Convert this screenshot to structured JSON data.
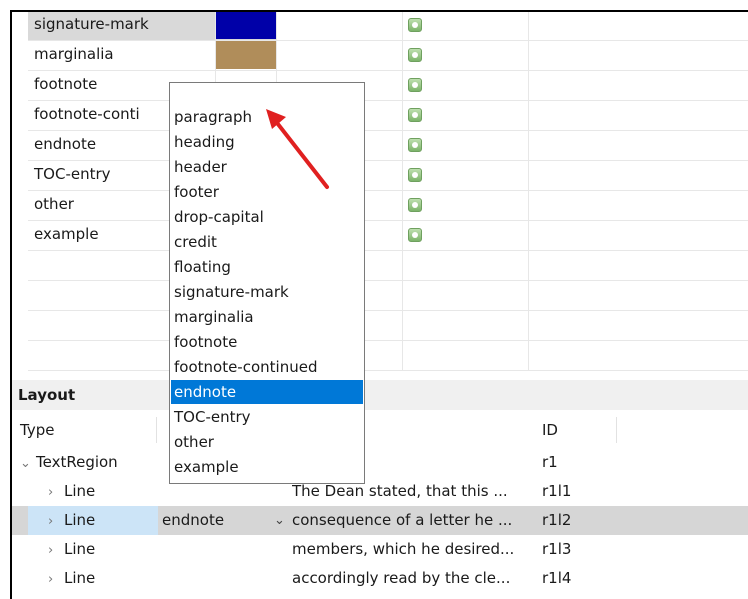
{
  "structure_rows": [
    {
      "name": "signature-mark",
      "color": "#0000a8",
      "selected": true
    },
    {
      "name": "marginalia",
      "color": "#b08d5a"
    },
    {
      "name": "footnote",
      "color": ""
    },
    {
      "name": "footnote-conti",
      "color": ""
    },
    {
      "name": "endnote",
      "color": ""
    },
    {
      "name": "TOC-entry",
      "color": ""
    },
    {
      "name": "other",
      "color": ""
    },
    {
      "name": "example",
      "color": ""
    }
  ],
  "layout": {
    "title": "Layout",
    "columns": {
      "type": "Type",
      "id": "ID"
    },
    "rows": [
      {
        "type": "TextRegion",
        "expanded": true,
        "level": 0,
        "struct": "",
        "text": "",
        "id": "r1"
      },
      {
        "type": "Line",
        "level": 1,
        "struct": "",
        "text": "The Dean stated, that this ...",
        "id": "r1l1"
      },
      {
        "type": "Line",
        "level": 1,
        "struct": "endnote",
        "text": "consequence of a letter he ...",
        "id": "r1l2",
        "selected": true
      },
      {
        "type": "Line",
        "level": 1,
        "struct": "",
        "text": "members, which he desired...",
        "id": "r1l3"
      },
      {
        "type": "Line",
        "level": 1,
        "struct": "",
        "text": "accordingly read by the cle...",
        "id": "r1l4"
      }
    ]
  },
  "dropdown": {
    "items": [
      "paragraph",
      "heading",
      "header",
      "footer",
      "drop-capital",
      "credit",
      "floating",
      "signature-mark",
      "marginalia",
      "footnote",
      "footnote-continued",
      "endnote",
      "TOC-entry",
      "other",
      "example"
    ],
    "highlighted": "endnote"
  },
  "colors": {
    "highlight": "#0078d7",
    "arrow": "#e02020",
    "selection_gray": "#d9d9d9"
  }
}
